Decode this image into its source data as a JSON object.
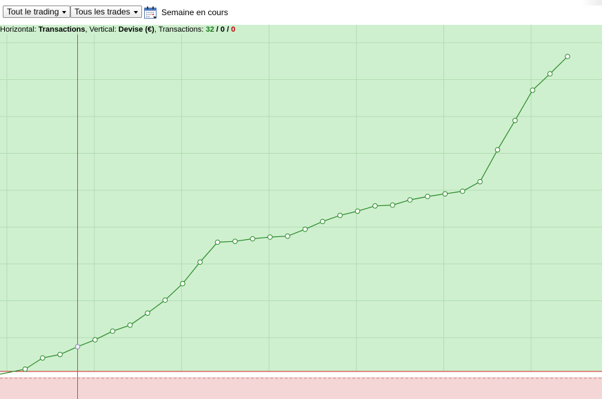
{
  "toolbar": {
    "filter_trading": "Tout le trading",
    "filter_trades": "Tous les trades",
    "period_label": "Semaine en cours",
    "calendar_icon": "calendar-icon"
  },
  "caption": {
    "horizontal_prefix": "Horizontal: ",
    "horizontal_value": "Transactions",
    "vertical_prefix": ", Vertical: ",
    "vertical_value": "Devise (€)",
    "transactions_prefix": ", Transactions: ",
    "count_total": "32",
    "sep1": " / ",
    "count_neutral": "0",
    "sep2": " / ",
    "count_loss": "0"
  },
  "colors": {
    "profit_area": "#cff0cf",
    "loss_area": "#f5d6d6",
    "grid": "#b3dcb3",
    "line": "#2a8a2a",
    "cursor": "#ff3333",
    "zero_line": "#cc2222"
  },
  "chart_data": {
    "type": "line",
    "x": [
      0,
      1,
      2,
      3,
      4,
      5,
      6,
      7,
      8,
      9,
      10,
      11,
      12,
      13,
      14,
      15,
      16,
      17,
      18,
      19,
      20,
      21,
      22,
      23,
      24,
      25,
      26,
      27,
      28,
      29,
      30,
      31,
      32
    ],
    "values": [
      0,
      5,
      18,
      22,
      31,
      39,
      49,
      56,
      70,
      85,
      104,
      129,
      152,
      153,
      156,
      158,
      159,
      167,
      176,
      183,
      188,
      194,
      195,
      201,
      205,
      208,
      211,
      222,
      259,
      293,
      328,
      347,
      367
    ],
    "ylim": [
      -5,
      375
    ],
    "xlim": [
      0,
      34.5
    ],
    "grid": true,
    "cursor_x": 4
  }
}
